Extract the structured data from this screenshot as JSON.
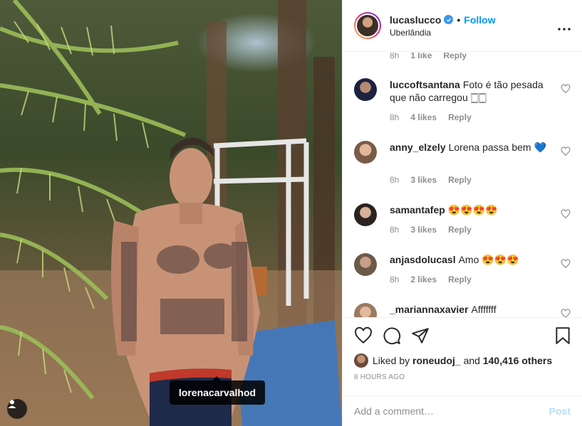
{
  "photo": {
    "tag_label": "lorenacarvalhod",
    "tag_icon": "user-icon"
  },
  "header": {
    "username": "lucaslucco",
    "verified_icon": "verified-badge-icon",
    "separator": "•",
    "follow_label": "Follow",
    "location": "Uberlândia",
    "more_icon": "ellipsis-icon"
  },
  "comments": {
    "top_partial": {
      "time": "8h",
      "likes": "1 like",
      "reply": "Reply"
    },
    "items": [
      {
        "user": "luccoftsantana",
        "text": "Foto é tão pesada que não carregou 🀆🀆",
        "time": "8h",
        "likes": "4 likes",
        "reply": "Reply"
      },
      {
        "user": "anny_elzely",
        "text": "Lorena passa bem 💙",
        "time": "8h",
        "likes": "3 likes",
        "reply": "Reply"
      },
      {
        "user": "samantafep",
        "text": "😍😍😍😍",
        "time": "8h",
        "likes": "3 likes",
        "reply": "Reply"
      },
      {
        "user": "anjasdolucasl",
        "text": "Amo 😍😍😍",
        "time": "8h",
        "likes": "2 likes",
        "reply": "Reply"
      },
      {
        "user": "_mariannaxavier",
        "text": "Afffffff",
        "time": "",
        "likes": "",
        "reply": ""
      }
    ]
  },
  "actions": {
    "liked_by_prefix": "Liked by",
    "liked_by_user": "roneudoj_",
    "and": "and",
    "others": "140,416 others",
    "time_ago": "8 HOURS AGO"
  },
  "composer": {
    "placeholder": "Add a comment…",
    "post_label": "Post"
  },
  "colors": {
    "accent": "#0095f6",
    "muted": "#8e8e8e",
    "post_disabled": "#b2dffc"
  }
}
